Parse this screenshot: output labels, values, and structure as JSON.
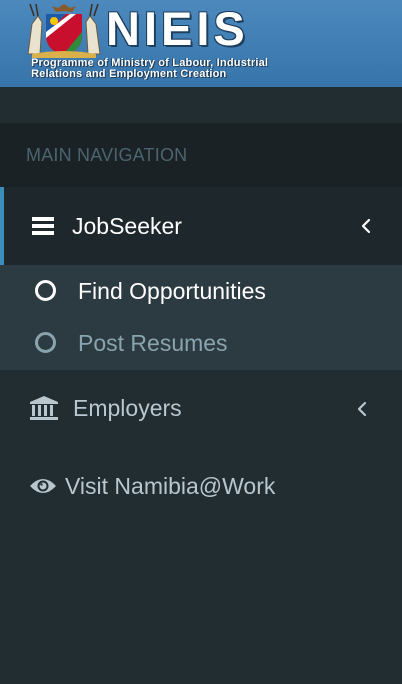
{
  "banner": {
    "brand": "NIEIS",
    "subtitle_line1": "Programme of Ministry of Labour, Industrial",
    "subtitle_line2": "Relations and Employment Creation",
    "crest_icon": "coat-of-arms-logo"
  },
  "sidebar": {
    "header": "MAIN NAVIGATION",
    "items": [
      {
        "label": "JobSeeker",
        "icon": "bars-icon",
        "expanded": true,
        "children": [
          {
            "label": "Find Opportunities",
            "icon": "circle-outline-icon",
            "active": true
          },
          {
            "label": "Post Resumes",
            "icon": "circle-outline-icon",
            "active": false
          }
        ]
      },
      {
        "label": "Employers",
        "icon": "bank-icon",
        "expanded": false
      },
      {
        "label": "Visit Namibia@Work",
        "icon": "eye-icon"
      }
    ]
  },
  "colors": {
    "sidebar_bg": "#222d32",
    "header_bg": "#1a2226",
    "active_bg": "#1e282c",
    "submenu_bg": "#2c3b41",
    "accent": "#3c8dbc",
    "muted_text": "#8aa4af",
    "link_text": "#b8c7ce"
  }
}
